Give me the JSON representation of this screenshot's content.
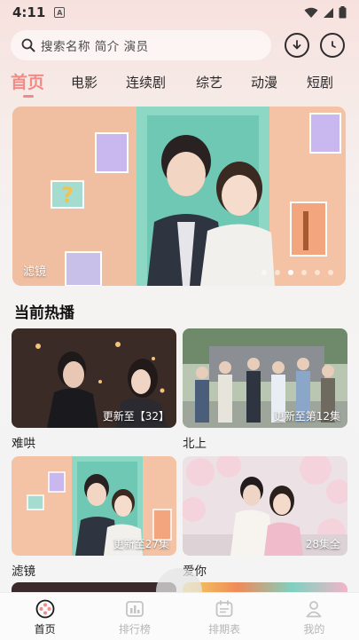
{
  "status_bar": {
    "time": "4:11",
    "notification_glyph": "A"
  },
  "search": {
    "placeholder": "搜索名称 简介 演员"
  },
  "tabs": [
    {
      "label": "首页",
      "active": true
    },
    {
      "label": "电影",
      "active": false
    },
    {
      "label": "连续剧",
      "active": false
    },
    {
      "label": "综艺",
      "active": false
    },
    {
      "label": "动漫",
      "active": false
    },
    {
      "label": "短剧",
      "active": false
    }
  ],
  "banner": {
    "label": "滤镜",
    "dot_count": 6,
    "active_dot": 2
  },
  "section": {
    "title": "当前热播"
  },
  "cards": [
    {
      "title": "难哄",
      "badge": "更新至【32】"
    },
    {
      "title": "北上",
      "badge": "更新至第12集"
    },
    {
      "title": "滤镜",
      "badge": "更新至27集"
    },
    {
      "title": "爱你",
      "badge": "28集全"
    }
  ],
  "bottom_nav": [
    {
      "label": "首页",
      "icon": "film-reel-icon",
      "active": true
    },
    {
      "label": "排行榜",
      "icon": "chart-icon",
      "active": false
    },
    {
      "label": "排期表",
      "icon": "calendar-icon",
      "active": false
    },
    {
      "label": "我的",
      "icon": "profile-icon",
      "active": false
    }
  ],
  "colors": {
    "accent": "#f18b86",
    "active_text": "#1a1a1a",
    "inactive_text": "#b5b5b5"
  }
}
